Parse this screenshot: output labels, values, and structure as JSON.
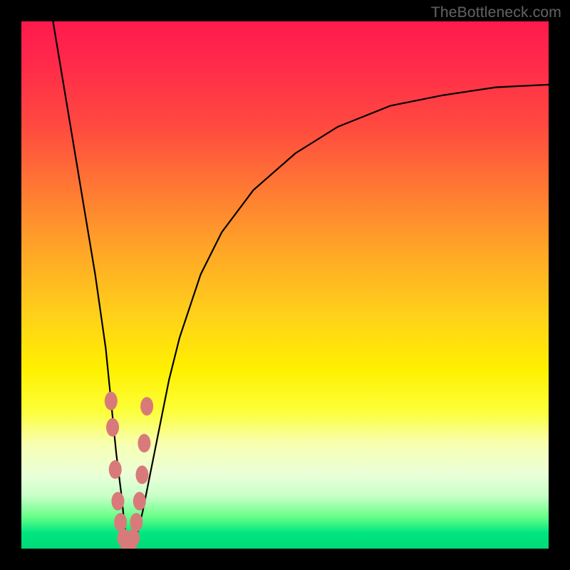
{
  "watermark": "TheBottleneck.com",
  "chart_data": {
    "type": "line",
    "title": "",
    "xlabel": "",
    "ylabel": "",
    "xlim": [
      0,
      100
    ],
    "ylim": [
      0,
      100
    ],
    "grid": false,
    "legend": false,
    "series": [
      {
        "name": "bottleneck-curve",
        "x": [
          6,
          8,
          10,
          12,
          14,
          16,
          17,
          18,
          19,
          19.5,
          20,
          20.5,
          21,
          22,
          23,
          24,
          26,
          28,
          30,
          34,
          38,
          44,
          52,
          60,
          70,
          80,
          90,
          100
        ],
        "y": [
          100,
          88,
          76,
          64,
          52,
          38,
          28,
          18,
          10,
          5,
          1,
          0.5,
          1,
          3,
          7,
          12,
          22,
          32,
          40,
          52,
          60,
          68,
          75,
          80,
          84,
          86,
          87.5,
          88
        ]
      }
    ],
    "markers": {
      "name": "highlighted-points",
      "color": "#d97a7a",
      "points": [
        {
          "x": 17.0,
          "y": 28
        },
        {
          "x": 17.3,
          "y": 23
        },
        {
          "x": 17.8,
          "y": 15
        },
        {
          "x": 18.3,
          "y": 9
        },
        {
          "x": 18.8,
          "y": 5
        },
        {
          "x": 19.4,
          "y": 2
        },
        {
          "x": 20.0,
          "y": 0.8
        },
        {
          "x": 20.6,
          "y": 0.7
        },
        {
          "x": 21.2,
          "y": 2
        },
        {
          "x": 21.8,
          "y": 5
        },
        {
          "x": 22.4,
          "y": 9
        },
        {
          "x": 22.9,
          "y": 14
        },
        {
          "x": 23.3,
          "y": 20
        },
        {
          "x": 23.8,
          "y": 27
        }
      ]
    },
    "gradient_stops": [
      {
        "pos": 0,
        "color": "#ff1a4d"
      },
      {
        "pos": 20,
        "color": "#ff4a3f"
      },
      {
        "pos": 44,
        "color": "#ffa826"
      },
      {
        "pos": 66,
        "color": "#fff000"
      },
      {
        "pos": 86,
        "color": "#eaffd8"
      },
      {
        "pos": 97,
        "color": "#00e682"
      },
      {
        "pos": 100,
        "color": "#00d977"
      }
    ]
  }
}
